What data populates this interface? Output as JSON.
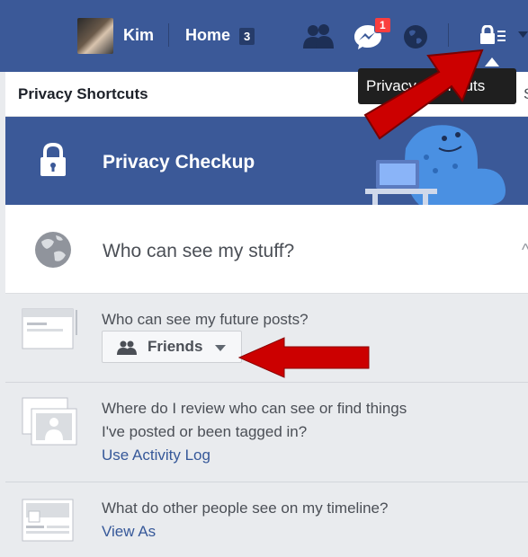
{
  "topbar": {
    "user_name": "Kim",
    "home_label": "Home",
    "home_count": "3",
    "messages_badge": "1"
  },
  "tooltip": {
    "text": "Privacy Shortcuts"
  },
  "header": {
    "title": "Privacy Shortcuts"
  },
  "checkup": {
    "label": "Privacy Checkup"
  },
  "section": {
    "title": "Who can see my stuff?"
  },
  "rows": [
    {
      "question": "Who can see my future posts?",
      "button_label": "Friends"
    },
    {
      "question_line1": "Where do I review who can see or find things",
      "question_line2": "I've posted or been tagged in?",
      "link": "Use Activity Log"
    },
    {
      "question": "What do other people see on my timeline?",
      "link": "View As"
    }
  ],
  "colors": {
    "brand_blue": "#3b5998",
    "link_blue": "#365899",
    "badge_red": "#fa3e3e",
    "annotation_red": "#cc0000",
    "background_gray": "#e9ebee"
  }
}
